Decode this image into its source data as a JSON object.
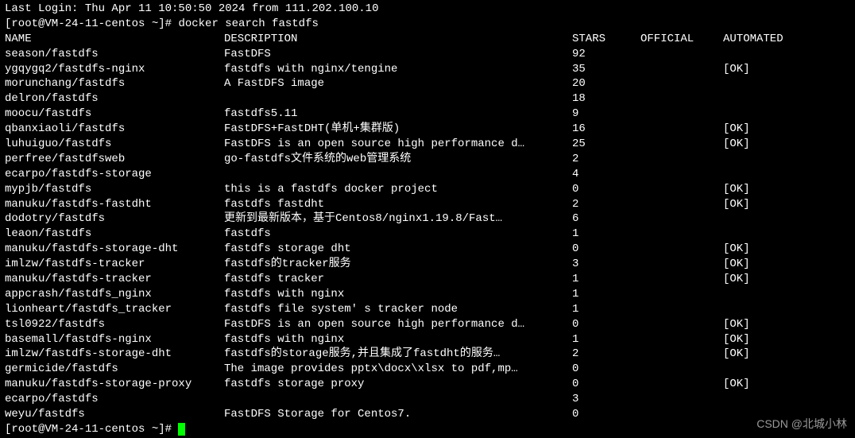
{
  "lastLogin": "Last Login: Thu Apr 11 10:50:50 2024 from 111.202.100.10",
  "prompt": "[root@VM-24-11-centos ~]# ",
  "command": "docker search fastdfs",
  "headers": {
    "name": "NAME",
    "description": "DESCRIPTION",
    "stars": "STARS",
    "official": "OFFICIAL",
    "automated": "AUTOMATED"
  },
  "rows": [
    {
      "name": "season/fastdfs",
      "description": "FastDFS",
      "stars": "92",
      "official": "",
      "automated": ""
    },
    {
      "name": "ygqygq2/fastdfs-nginx",
      "description": "fastdfs with nginx/tengine",
      "stars": "35",
      "official": "",
      "automated": "[OK]"
    },
    {
      "name": "morunchang/fastdfs",
      "description": "A FastDFS image",
      "stars": "20",
      "official": "",
      "automated": ""
    },
    {
      "name": "delron/fastdfs",
      "description": "",
      "stars": "18",
      "official": "",
      "automated": ""
    },
    {
      "name": "moocu/fastdfs",
      "description": "fastdfs5.11",
      "stars": "9",
      "official": "",
      "automated": ""
    },
    {
      "name": "qbanxiaoli/fastdfs",
      "description": "FastDFS+FastDHT(单机+集群版)",
      "stars": "16",
      "official": "",
      "automated": "[OK]"
    },
    {
      "name": "luhuiguo/fastdfs",
      "description": "FastDFS is an open source high performance d…",
      "stars": " 25",
      "official": "",
      "automated": "[OK]"
    },
    {
      "name": "perfree/fastdfsweb",
      "description": "go-fastdfs文件系统的web管理系统",
      "stars": "2",
      "official": "",
      "automated": ""
    },
    {
      "name": "ecarpo/fastdfs-storage",
      "description": "",
      "stars": "4",
      "official": "",
      "automated": ""
    },
    {
      "name": "mypjb/fastdfs",
      "description": "this is a fastdfs docker project",
      "stars": "0",
      "official": "",
      "automated": "[OK]"
    },
    {
      "name": "manuku/fastdfs-fastdht",
      "description": "fastdfs fastdht",
      "stars": "2",
      "official": "",
      "automated": "[OK]"
    },
    {
      "name": "dodotry/fastdfs",
      "description": "更新到最新版本，基于Centos8/nginx1.19.8/Fast…",
      "stars": " 6",
      "official": "",
      "automated": ""
    },
    {
      "name": "leaon/fastdfs",
      "description": "fastdfs",
      "stars": "1",
      "official": "",
      "automated": ""
    },
    {
      "name": "manuku/fastdfs-storage-dht",
      "description": "fastdfs storage dht",
      "stars": "0",
      "official": "",
      "automated": "[OK]"
    },
    {
      "name": "imlzw/fastdfs-tracker",
      "description": "fastdfs的tracker服务",
      "stars": "3",
      "official": "",
      "automated": "[OK]"
    },
    {
      "name": "manuku/fastdfs-tracker",
      "description": "fastdfs tracker",
      "stars": "1",
      "official": "",
      "automated": "[OK]"
    },
    {
      "name": "appcrash/fastdfs_nginx",
      "description": "fastdfs with nginx",
      "stars": "1",
      "official": "",
      "automated": ""
    },
    {
      "name": "lionheart/fastdfs_tracker",
      "description": "fastdfs file system' s tracker node",
      "stars": " 1",
      "official": "",
      "automated": ""
    },
    {
      "name": "tsl0922/fastdfs",
      "description": "FastDFS is an open source high performance d…",
      "stars": " 0",
      "official": "",
      "automated": "[OK]"
    },
    {
      "name": "basemall/fastdfs-nginx",
      "description": "fastdfs with nginx",
      "stars": "1",
      "official": "",
      "automated": "[OK]"
    },
    {
      "name": "imlzw/fastdfs-storage-dht",
      "description": "fastdfs的storage服务,并且集成了fastdht的服务…",
      "stars": " 2",
      "official": "",
      "automated": "[OK]"
    },
    {
      "name": "germicide/fastdfs",
      "description": "The image provides  pptx\\docx\\xlsx to pdf,mp…",
      "stars": " 0",
      "official": "",
      "automated": ""
    },
    {
      "name": "manuku/fastdfs-storage-proxy",
      "description": "fastdfs storage proxy",
      "stars": "0",
      "official": "",
      "automated": "[OK]"
    },
    {
      "name": "ecarpo/fastdfs",
      "description": "",
      "stars": "3",
      "official": "",
      "automated": ""
    },
    {
      "name": "weyu/fastdfs",
      "description": "FastDFS Storage for Centos7.",
      "stars": "0",
      "official": "",
      "automated": ""
    }
  ],
  "watermark": "CSDN @北城小林"
}
